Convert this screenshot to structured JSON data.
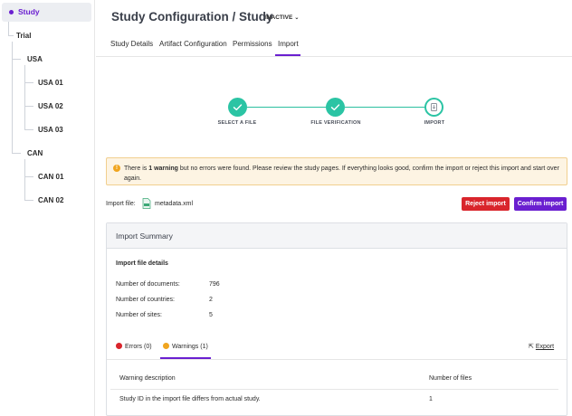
{
  "sidebar": {
    "study_label": "Study",
    "tree": {
      "trial": "Trial",
      "usa": "USA",
      "usa_01": "USA 01",
      "usa_02": "USA 02",
      "usa_03": "USA 03",
      "can": "CAN",
      "can_01": "CAN 01",
      "can_02": "CAN 02"
    }
  },
  "header": {
    "title": "Study Configuration / Study",
    "status": "INACTIVE"
  },
  "tabs": [
    "Study Details",
    "Artifact Configuration",
    "Permissions",
    "Import"
  ],
  "stepper": {
    "steps": [
      {
        "label": "SELECT A FILE",
        "state": "done"
      },
      {
        "label": "FILE VERIFICATION",
        "state": "done"
      },
      {
        "label": "IMPORT",
        "state": "current"
      }
    ]
  },
  "warning": {
    "prefix": "There is ",
    "bold": "1 warning",
    "suffix": " but no errors were found. Please review the study pages. If everything looks good, confirm the import or reject this import and start over again."
  },
  "import_file": {
    "label": "Import file:",
    "file_name": "metadata.xml",
    "reject_label": "Reject import",
    "confirm_label": "Confirm import"
  },
  "summary": {
    "title": "Import Summary",
    "details_title": "Import file details",
    "rows": [
      {
        "label": "Number of documents:",
        "value": "796"
      },
      {
        "label": "Number of countries:",
        "value": "2"
      },
      {
        "label": "Number of sites:",
        "value": "5"
      }
    ],
    "result_tabs": {
      "errors": "Errors (0)",
      "warnings": "Warnings (1)",
      "export": "Export"
    },
    "table": {
      "headers": [
        "Warning description",
        "Number of files"
      ],
      "rows": [
        [
          "Study ID in the import file differs from actual study.",
          "1"
        ]
      ]
    }
  },
  "colors": {
    "accent": "#6a1fd0",
    "success": "#2bc4a4",
    "danger": "#d9252c",
    "warning": "#f0a51f"
  }
}
